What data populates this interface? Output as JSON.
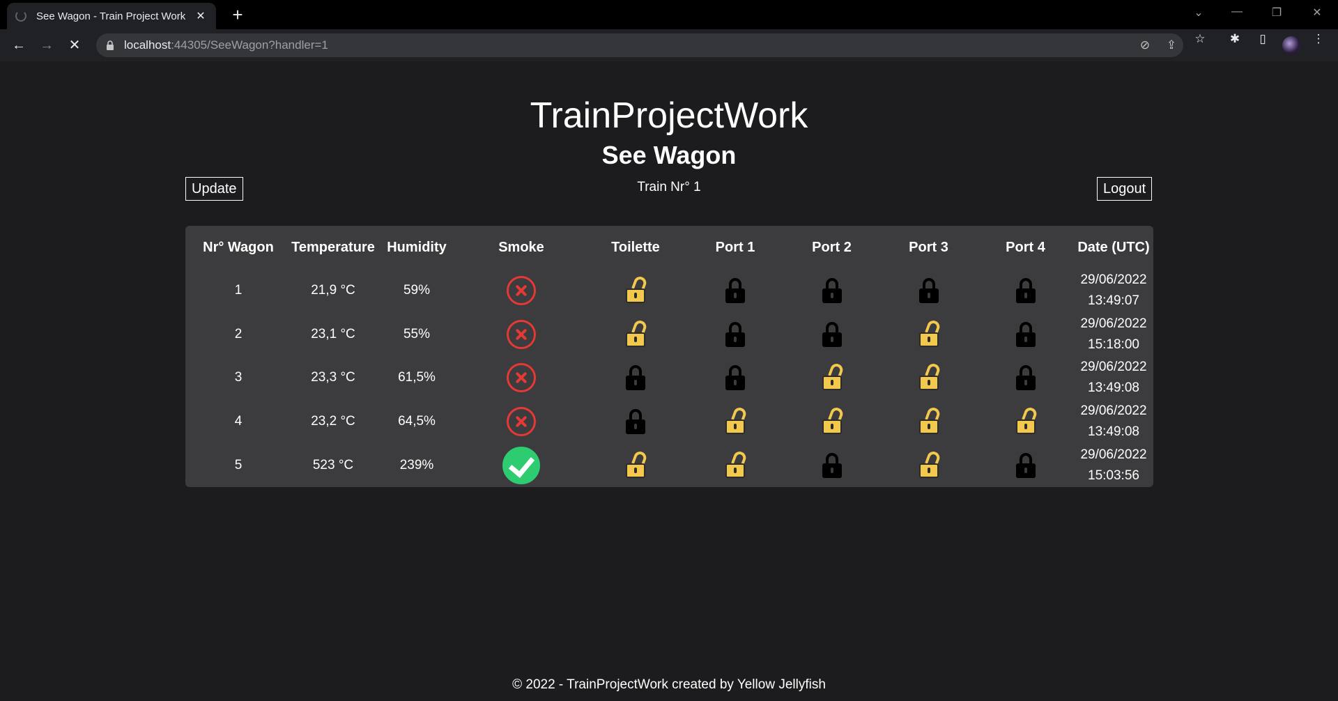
{
  "browser": {
    "tab_title": "See Wagon - Train Project Work",
    "tab_close": "✕",
    "new_tab": "+",
    "url_host": "localhost",
    "url_rest": ":44305/SeeWagon?handler=1"
  },
  "site": {
    "title": "TrainProjectWork",
    "heading": "See Wagon",
    "train_label": "Train Nr° 1",
    "update_label": "Update",
    "logout_label": "Logout",
    "footer": "© 2022 - TrainProjectWork created by Yellow Jellyfish"
  },
  "table": {
    "headers": [
      "Nr° Wagon",
      "Temperature",
      "Humidity",
      "Smoke",
      "Toilette",
      "Port 1",
      "Port 2",
      "Port 3",
      "Port 4",
      "Date (UTC)"
    ],
    "rows": [
      {
        "nr": "1",
        "temperature": "21,9 °C",
        "humidity": "59%",
        "smoke": false,
        "toilette": "open",
        "port1": "locked",
        "port2": "locked",
        "port3": "locked",
        "port4": "locked",
        "date": "29/06/2022",
        "time": "13:49:07"
      },
      {
        "nr": "2",
        "temperature": "23,1 °C",
        "humidity": "55%",
        "smoke": false,
        "toilette": "open",
        "port1": "locked",
        "port2": "locked",
        "port3": "open",
        "port4": "locked",
        "date": "29/06/2022",
        "time": "15:18:00"
      },
      {
        "nr": "3",
        "temperature": "23,3 °C",
        "humidity": "61,5%",
        "smoke": false,
        "toilette": "locked",
        "port1": "locked",
        "port2": "open",
        "port3": "open",
        "port4": "locked",
        "date": "29/06/2022",
        "time": "13:49:08"
      },
      {
        "nr": "4",
        "temperature": "23,2 °C",
        "humidity": "64,5%",
        "smoke": false,
        "toilette": "locked",
        "port1": "open",
        "port2": "open",
        "port3": "open",
        "port4": "open",
        "date": "29/06/2022",
        "time": "13:49:08"
      },
      {
        "nr": "5",
        "temperature": "523 °C",
        "humidity": "239%",
        "smoke": true,
        "toilette": "open",
        "port1": "open",
        "port2": "locked",
        "port3": "open",
        "port4": "locked",
        "date": "29/06/2022",
        "time": "15:03:56"
      }
    ]
  },
  "colors": {
    "background": "#1c1c1e",
    "panel": "#3c3c3e",
    "smoke_no": "#e53935",
    "smoke_yes": "#2ecc71",
    "lock_open": "#f2c94c",
    "lock_locked": "#000000"
  },
  "icons": {
    "smoke_false": "x-circle-icon",
    "smoke_true": "check-circle-icon",
    "door_open": "unlocked-padlock-icon",
    "door_locked": "locked-padlock-icon"
  }
}
